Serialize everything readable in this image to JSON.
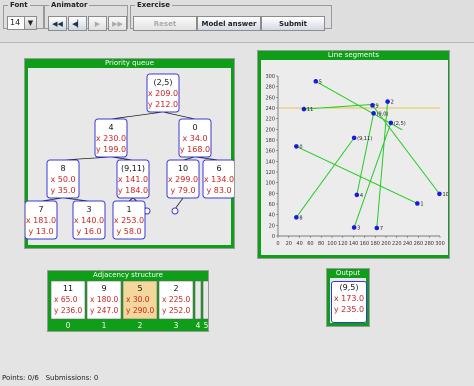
{
  "toolbar": {
    "font_group": "Font",
    "font_size": "14",
    "animator_group": "Animator",
    "exercise_group": "Exercise",
    "reset_label": "Reset",
    "model_answer_label": "Model answer",
    "submit_label": "Submit"
  },
  "priority_queue": {
    "title": "Priority queue",
    "nodes": [
      {
        "key": "(2,5)",
        "x": "x 209.0",
        "y": "y 212.0"
      },
      {
        "key": "4",
        "x": "x 230.0",
        "y": "y 199.0"
      },
      {
        "key": "0",
        "x": "x 34.0",
        "y": "y 168.0"
      },
      {
        "key": "8",
        "x": "x 50.0",
        "y": "y 35.0"
      },
      {
        "key": "(9,11)",
        "x": "x 141.0",
        "y": "y 184.0"
      },
      {
        "key": "10",
        "x": "x 299.0",
        "y": "y 79.0"
      },
      {
        "key": "6",
        "x": "x 134.0",
        "y": "y 83.0"
      },
      {
        "key": "7",
        "x": "x 181.0",
        "y": "y 13.0"
      },
      {
        "key": "3",
        "x": "x 140.0",
        "y": "y 16.0"
      },
      {
        "key": "1",
        "x": "x 253.0",
        "y": "y 58.0"
      }
    ]
  },
  "line_segments": {
    "title": "Line segments",
    "x_ticks": [
      "0",
      "20",
      "40",
      "60",
      "80",
      "100",
      "120",
      "140",
      "160",
      "180",
      "200",
      "220",
      "240",
      "260",
      "280",
      "300"
    ],
    "y_ticks": [
      "300",
      "280",
      "260",
      "240",
      "220",
      "200",
      "180",
      "160",
      "140",
      "120",
      "100",
      "80",
      "60",
      "40",
      "20",
      "0"
    ],
    "sweep_y": 240,
    "points": [
      {
        "label": "5",
        "x": 70,
        "y": 290
      },
      {
        "label": "11",
        "x": 48,
        "y": 238
      },
      {
        "label": "9",
        "x": 175,
        "y": 245
      },
      {
        "label": "(9,0)",
        "x": 177,
        "y": 230
      },
      {
        "label": "2",
        "x": 203,
        "y": 252
      },
      {
        "label": "(2,5)",
        "x": 209,
        "y": 212
      },
      {
        "label": "(9,11)",
        "x": 141,
        "y": 184
      },
      {
        "label": "0",
        "x": 34,
        "y": 168
      },
      {
        "label": "4",
        "x": 146,
        "y": 77
      },
      {
        "label": "10",
        "x": 299,
        "y": 79
      },
      {
        "label": "1",
        "x": 258,
        "y": 61
      },
      {
        "label": "8",
        "x": 34,
        "y": 35
      },
      {
        "label": "3",
        "x": 141,
        "y": 16
      },
      {
        "label": "7",
        "x": 183,
        "y": 15
      }
    ],
    "segments": [
      {
        "x1": 70,
        "y1": 290,
        "x2": 230,
        "y2": 199
      },
      {
        "x1": 48,
        "y1": 238,
        "x2": 180,
        "y2": 247
      },
      {
        "x1": 34,
        "y1": 168,
        "x2": 258,
        "y2": 61
      },
      {
        "x1": 175,
        "y1": 245,
        "x2": 299,
        "y2": 79
      },
      {
        "x1": 203,
        "y1": 252,
        "x2": 183,
        "y2": 15
      },
      {
        "x1": 209,
        "y1": 212,
        "x2": 141,
        "y2": 16
      },
      {
        "x1": 141,
        "y1": 184,
        "x2": 34,
        "y2": 35
      },
      {
        "x1": 177,
        "y1": 230,
        "x2": 146,
        "y2": 77
      }
    ],
    "colors": {
      "axis": "#555555",
      "segment": "#22cc22",
      "point": "#1a1add",
      "sweep": "#e6c34a"
    }
  },
  "adjacency": {
    "title": "Adjacency structure",
    "cells": [
      {
        "key": "11",
        "x": "x 65.0",
        "y": "y 236.0",
        "index": "0",
        "highlight": false
      },
      {
        "key": "9",
        "x": "x 180.0",
        "y": "y 247.0",
        "index": "1",
        "highlight": false
      },
      {
        "key": "5",
        "x": "x 30.0",
        "y": "y 290.0",
        "index": "2",
        "highlight": true
      },
      {
        "key": "2",
        "x": "x 225.0",
        "y": "y 252.0",
        "index": "3",
        "highlight": false
      }
    ],
    "extra_indices": [
      "4",
      "5"
    ]
  },
  "output": {
    "title": "Output",
    "key": "(9,5)",
    "x": "x 173.0",
    "y": "y 235.0"
  },
  "status": {
    "points_label": "Points: 0/6",
    "submissions_label": "Submissions: 0"
  },
  "colors": {
    "green": "#0e9e17",
    "node_border": "#3838d0",
    "value_red": "#cc2222",
    "highlight": "#f4d79a"
  }
}
